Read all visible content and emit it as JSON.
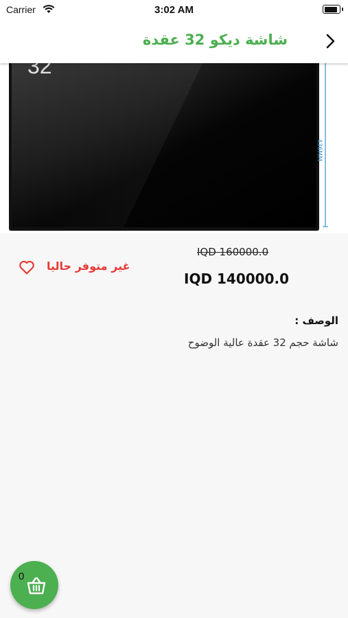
{
  "status_bar": {
    "carrier": "Carrier",
    "time": "3:02 AM",
    "battery_level": 1.0
  },
  "nav": {
    "title": "شاشة ديكو 32 عقدة",
    "back_icon": "chevron-right-icon"
  },
  "product_image": {
    "screen_label": "32",
    "dimension_label": "436MM"
  },
  "price": {
    "old": "IQD 160000.0",
    "current": "IQD 140000.0"
  },
  "availability": {
    "status": "غير متوفر حاليا",
    "status_color": "#e53935",
    "favorite_icon": "heart-outline-icon"
  },
  "description": {
    "title": "الوصف :",
    "text": "شاشة حجم 32 عقدة عالية الوضوح"
  },
  "cart": {
    "count": "0",
    "icon": "basket-icon",
    "color": "#4caf50"
  },
  "theme": {
    "accent": "#4caf50",
    "danger": "#e53935"
  }
}
